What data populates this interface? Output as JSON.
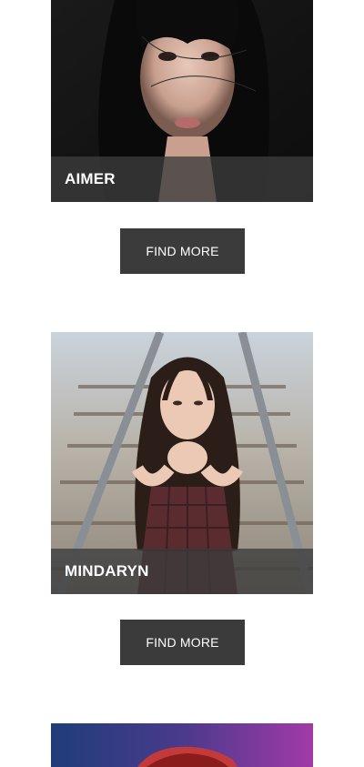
{
  "artists": [
    {
      "name": "AIMER",
      "button_label": "FIND MORE"
    },
    {
      "name": "MINDARYN",
      "button_label": "FIND MORE"
    }
  ],
  "third_card": {
    "visible": "partial"
  }
}
